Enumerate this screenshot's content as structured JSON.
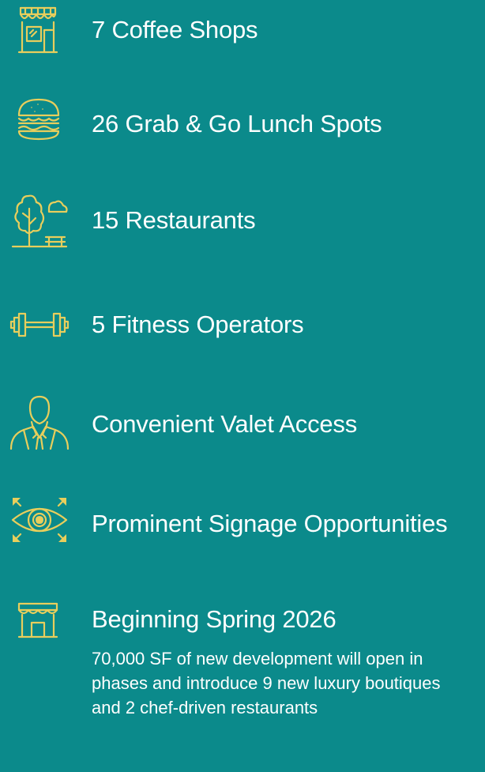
{
  "colors": {
    "background": "#0B8A8B",
    "icon_accent": "#E8CE5C",
    "text": "#FFFFFF"
  },
  "amenities": [
    {
      "icon": "storefront-icon",
      "label": "7 Coffee Shops"
    },
    {
      "icon": "burger-icon",
      "label": "26 Grab & Go Lunch Spots"
    },
    {
      "icon": "park-tree-icon",
      "label": "15 Restaurants"
    },
    {
      "icon": "dumbbell-icon",
      "label": "5 Fitness Operators"
    },
    {
      "icon": "valet-person-icon",
      "label": "Convenient Valet Access"
    },
    {
      "icon": "eye-visibility-icon",
      "label": "Prominent Signage Opportunities"
    },
    {
      "icon": "shop-awning-icon",
      "label": "Beginning Spring 2026"
    }
  ],
  "development": {
    "description": "70,000 SF of new development will open in phases and introduce 9 new luxury boutiques and 2 chef-driven restaurants"
  }
}
